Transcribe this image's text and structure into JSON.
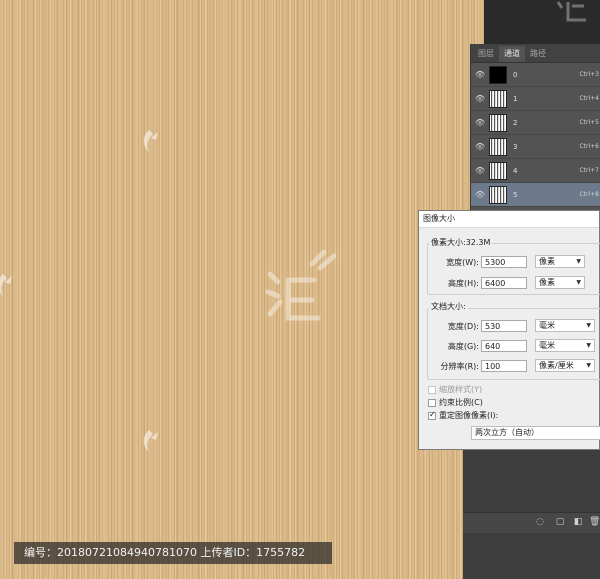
{
  "channels_panel": {
    "tabs": [
      {
        "label": "图层",
        "active": false
      },
      {
        "label": "通道",
        "active": true
      },
      {
        "label": "路径",
        "active": false
      }
    ],
    "rows": [
      {
        "name": "0",
        "shortcut": "Ctrl+3",
        "thumb": "black",
        "selected": false
      },
      {
        "name": "1",
        "shortcut": "Ctrl+4",
        "thumb": "noise",
        "selected": false
      },
      {
        "name": "2",
        "shortcut": "Ctrl+5",
        "thumb": "noise",
        "selected": false
      },
      {
        "name": "3",
        "shortcut": "Ctrl+6",
        "thumb": "noise",
        "selected": false
      },
      {
        "name": "4",
        "shortcut": "Ctrl+7",
        "thumb": "noise",
        "selected": false
      },
      {
        "name": "5",
        "shortcut": "Ctrl+8",
        "thumb": "noise",
        "selected": true
      }
    ]
  },
  "dialog": {
    "title": "图像大小",
    "pixel_dimensions": {
      "label": "像素大小:32.3M",
      "width_label": "宽度(W):",
      "width_value": "5300",
      "width_unit": "像素",
      "height_label": "高度(H):",
      "height_value": "6400",
      "height_unit": "像素"
    },
    "document_size": {
      "label": "文档大小:",
      "width_label": "宽度(D):",
      "width_value": "530",
      "width_unit": "毫米",
      "height_label": "高度(G):",
      "height_value": "640",
      "height_unit": "毫米",
      "resolution_label": "分辨率(R):",
      "resolution_value": "100",
      "resolution_unit": "像素/厘米"
    },
    "scale_styles": {
      "label": "缩放样式(Y)",
      "checked": false,
      "disabled": true
    },
    "constrain": {
      "label": "约束比例(C)",
      "checked": false
    },
    "resample": {
      "label": "重定图像像素(I):",
      "checked": true
    },
    "resample_method": "两次立方（自动）"
  },
  "caption": "编号：20180721084940781070 上传者ID：1755782"
}
